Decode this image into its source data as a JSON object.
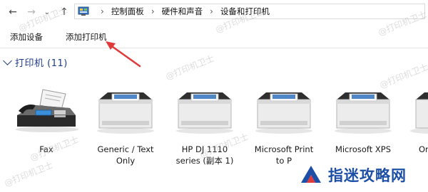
{
  "breadcrumb": [
    "控制面板",
    "硬件和声音",
    "设备和打印机"
  ],
  "commands": {
    "add_device": "添加设备",
    "add_printer": "添加打印机"
  },
  "group": {
    "title": "打印机 (11)"
  },
  "devices": [
    {
      "label": "Fax",
      "icon": "fax-icon"
    },
    {
      "label": "Generic / Text\nOnly",
      "icon": "printer-icon"
    },
    {
      "label": "HP DJ 1110\nseries (副本 1)",
      "icon": "printer-icon"
    },
    {
      "label": "Microsoft Print\nto P",
      "icon": "printer-icon"
    },
    {
      "label": "Microsoft XPS",
      "icon": "printer-icon"
    },
    {
      "label": "On",
      "icon": "printer-icon"
    }
  ],
  "watermark_text": "@打印机卫士",
  "brand": {
    "text": "指迷攻略网",
    "color": "#1e4fa6"
  },
  "colors": {
    "group_title": "#1e3a8a",
    "annotation_arrow": "#e03a3a"
  }
}
